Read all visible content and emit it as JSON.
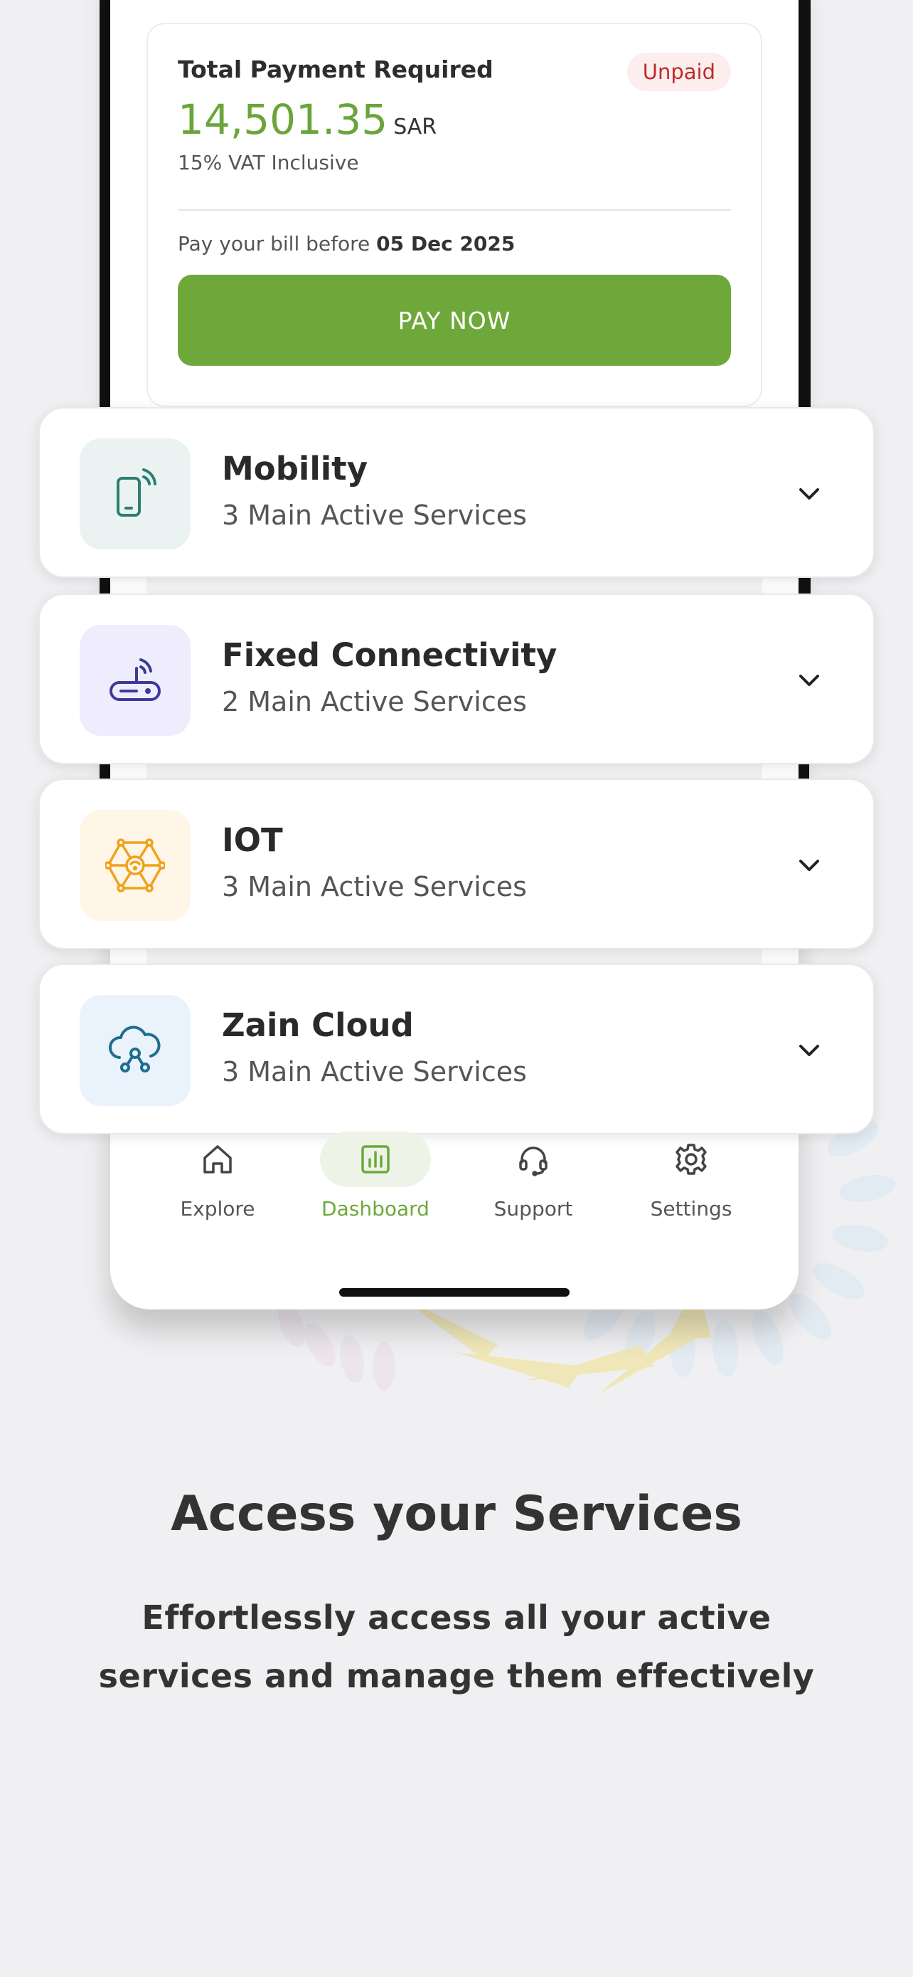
{
  "payment": {
    "title": "Total Payment Required",
    "status": "Unpaid",
    "amount": "14,501.35",
    "currency": "SAR",
    "vat_note": "15% VAT Inclusive",
    "due_prefix": "Pay your bill before",
    "due_date": "05 Dec 2025",
    "pay_button": "PAY NOW"
  },
  "services": [
    {
      "name": "Mobility",
      "subtitle": "3 Main Active Services",
      "icon": "mobile-signal-icon",
      "icon_bg": "#eaf3f1",
      "icon_color": "#2e7d73"
    },
    {
      "name": "Fixed Connectivity",
      "subtitle": "2 Main Active Services",
      "icon": "router-icon",
      "icon_bg": "#efedfd",
      "icon_color": "#3d3a9a"
    },
    {
      "name": "IOT",
      "subtitle": "3 Main Active Services",
      "icon": "iot-network-icon",
      "icon_bg": "#fff6e8",
      "icon_color": "#f0a21c"
    },
    {
      "name": "Zain Cloud",
      "subtitle": "3 Main Active Services",
      "icon": "cloud-network-icon",
      "icon_bg": "#eaf3fc",
      "icon_color": "#1f6e8f"
    }
  ],
  "nav": {
    "items": [
      {
        "label": "Explore",
        "icon": "home-icon"
      },
      {
        "label": "Dashboard",
        "icon": "bar-chart-icon",
        "active": true
      },
      {
        "label": "Support",
        "icon": "headset-icon"
      },
      {
        "label": "Settings",
        "icon": "gear-icon"
      }
    ]
  },
  "onboarding": {
    "headline": "Access your Services",
    "description": "Effortlessly access all your active services and manage them effectively"
  },
  "colors": {
    "accent_green": "#6ea83a",
    "unpaid_red": "#c02a2a",
    "background": "#f0f0f2"
  }
}
